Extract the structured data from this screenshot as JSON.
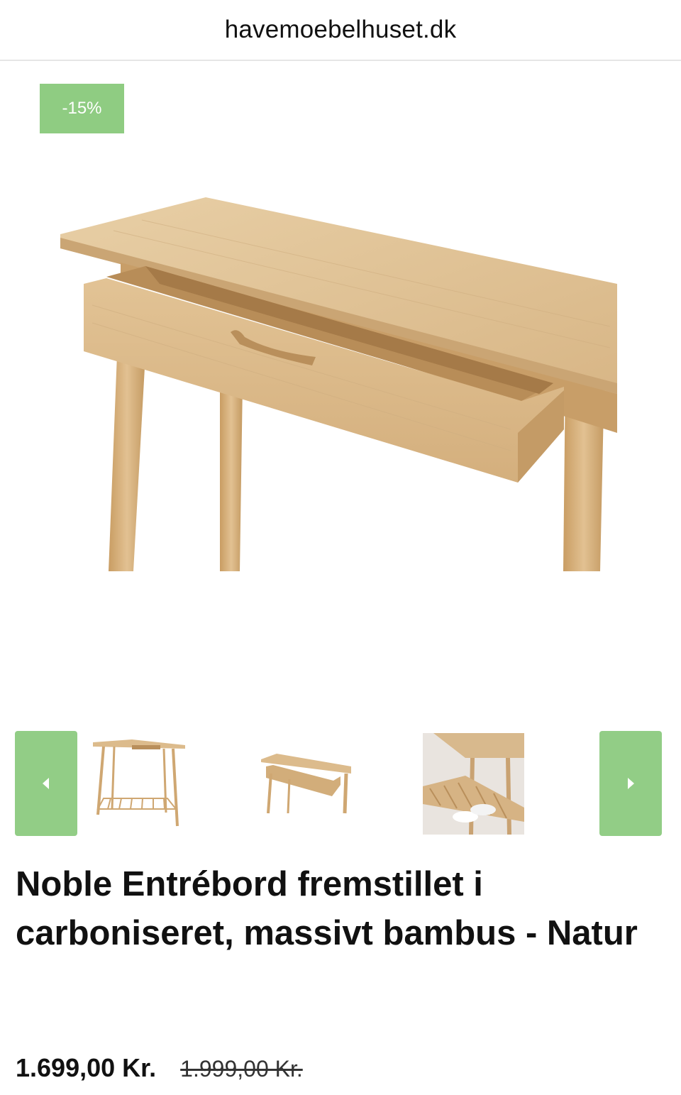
{
  "browser": {
    "url": "havemoebelhuset.dk"
  },
  "product": {
    "discount_badge": "-15%",
    "title": "Noble Entrébord fremstillet i carboniseret, massivt bambus - Natur",
    "price": "1.699,00 Kr.",
    "old_price": "1.999,00 Kr."
  },
  "gallery": {
    "prev_icon": "chevron-left-icon",
    "next_icon": "chevron-right-icon",
    "thumbnails": [
      "console-table-with-shelf",
      "console-table-drawer-open",
      "console-table-shelf-with-shoes"
    ]
  },
  "colors": {
    "accent": "#92cd86",
    "wood": "#d9b98c"
  }
}
